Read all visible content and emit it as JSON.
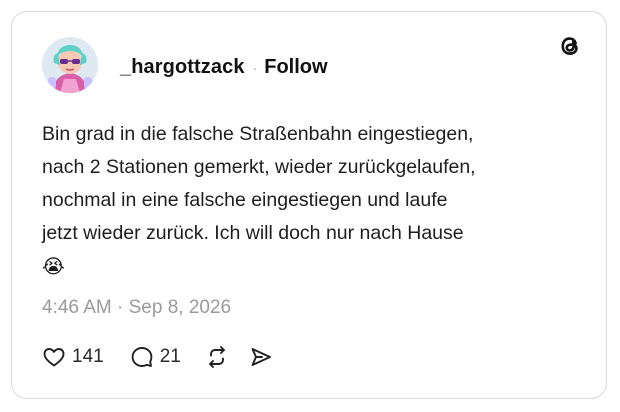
{
  "post": {
    "username": "_hargottzack",
    "follow_label": "Follow",
    "separator": "·",
    "text_lines": [
      "Bin grad in die falsche Straßenbahn eingestiegen,",
      "nach 2 Stationen gemerkt, wieder zurückgelaufen,",
      "nochmal in eine falsche eingestiegen und laufe",
      "jetzt wieder zurück. Ich will doch nur nach Hause"
    ],
    "emoji": "😭",
    "time": "4:46 AM",
    "date": "Sep 8, 2026",
    "meta_separator": "·",
    "likes": "141",
    "replies": "21"
  },
  "icons": {
    "brand": "threads-logo-icon",
    "like": "heart-icon",
    "reply": "comment-bubble-icon",
    "repost": "repost-icon",
    "share": "share-send-icon"
  },
  "colors": {
    "text": "#1e1e1e",
    "muted": "#9a9a9a",
    "border": "#d9d9d9"
  }
}
